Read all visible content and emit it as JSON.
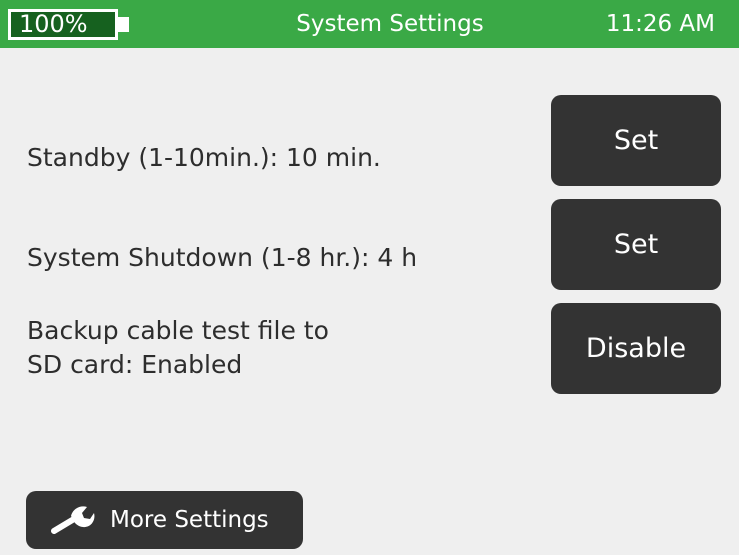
{
  "status_bar": {
    "battery_level": "100%",
    "title": "System Settings",
    "time": "11:26 AM"
  },
  "settings": [
    {
      "label": "Standby (1-10min.): 10 min.",
      "button": "Set"
    },
    {
      "label": "System Shutdown (1-8 hr.): 4 h",
      "button": "Set"
    },
    {
      "label_line1": "Backup cable test file to",
      "label_line2": "SD card: Enabled",
      "button": "Disable"
    }
  ],
  "footer": {
    "more_settings_label": "More Settings",
    "icon": "wrench-icon"
  },
  "colors": {
    "status_bar": "#3aa946",
    "battery_fill": "#16611f",
    "background": "#efefef",
    "button": "#333333",
    "text": "#2d2d2d"
  }
}
